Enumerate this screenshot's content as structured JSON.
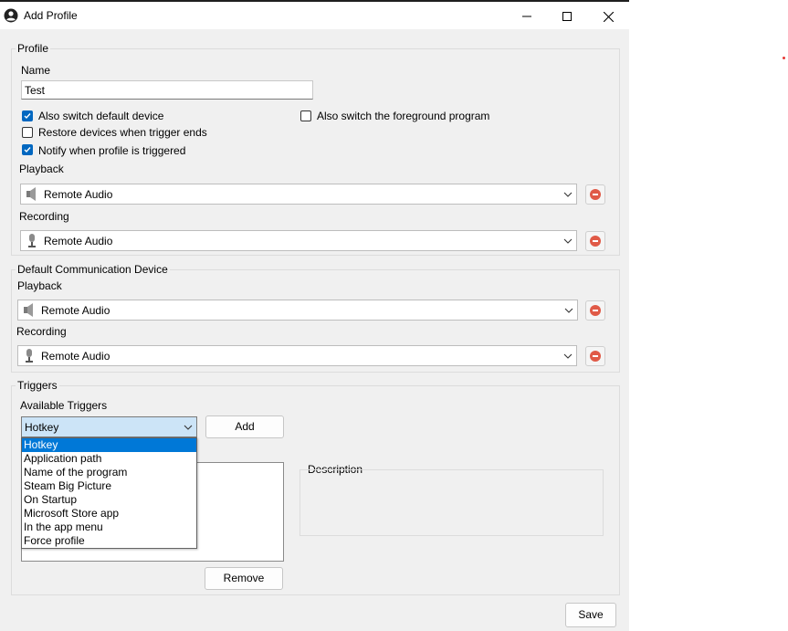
{
  "window": {
    "title": "Add Profile",
    "controls": {
      "minimize": "minimize-icon",
      "maximize": "maximize-icon",
      "close": "close-icon"
    }
  },
  "profile": {
    "group_label": "Profile",
    "name_label": "Name",
    "name_value": "Test",
    "checkboxes": [
      {
        "label": "Also switch default device",
        "checked": true
      },
      {
        "label": "Restore devices when trigger ends",
        "checked": false
      },
      {
        "label": "Notify when profile is triggered",
        "checked": true
      },
      {
        "label": "Also switch the foreground program",
        "checked": false
      }
    ],
    "playback_label": "Playback",
    "playback_value": "Remote Audio",
    "recording_label": "Recording",
    "recording_value": "Remote Audio"
  },
  "communication": {
    "group_label": "Default Communication Device",
    "playback_label": "Playback",
    "playback_value": "Remote Audio",
    "recording_label": "Recording",
    "recording_value": "Remote Audio"
  },
  "triggers": {
    "group_label": "Triggers",
    "available_label": "Available Triggers",
    "selected": "Hotkey",
    "add_label": "Add",
    "remove_label": "Remove",
    "description_label": "Description",
    "options": [
      "Hotkey",
      "Application path",
      "Name of the program",
      "Steam Big Picture",
      "On Startup",
      "Microsoft Store app",
      "In the app menu",
      "Force profile"
    ]
  },
  "footer": {
    "save_label": "Save"
  },
  "colors": {
    "accent": "#0067c0",
    "selection": "#0078d7",
    "combo_highlight": "#cce4f7",
    "remove": "#e05a47"
  }
}
